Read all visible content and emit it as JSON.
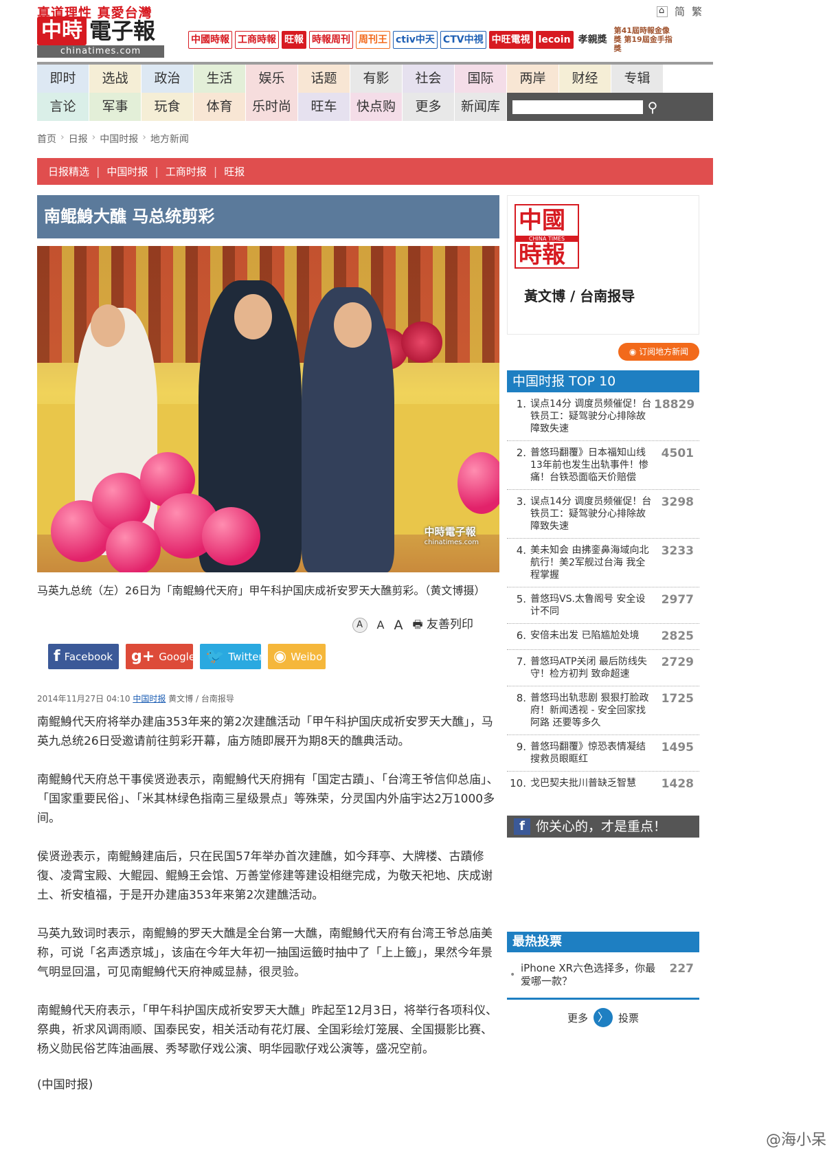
{
  "header": {
    "slogan": "真道理性 真愛台灣",
    "logo_box": "中時",
    "logo_text": "電子報",
    "logo_url": "chinatimes.com",
    "partners": [
      "中國時報",
      "工商時報",
      "旺報",
      "時報周刊",
      "周刊王",
      "ctiv中天",
      "CTV中視",
      "中旺電視",
      "lecoin",
      "孝親獎",
      "第41屆時報金像獎 第19屆金手指獎"
    ],
    "lang": [
      "简",
      "繁"
    ]
  },
  "nav": {
    "row1": [
      "即时",
      "选战",
      "政治",
      "生活",
      "娱乐",
      "话题",
      "有影",
      "社会",
      "国际",
      "两岸",
      "财经",
      "专辑"
    ],
    "row2": [
      "言论",
      "军事",
      "玩食",
      "体育",
      "乐时尚",
      "旺车",
      "快点购",
      "更多",
      "新闻库"
    ],
    "search_placeholder": ""
  },
  "breadcrumb": [
    "首页",
    "日报",
    "中国时报",
    "地方新闻"
  ],
  "subnav": [
    "日报精选",
    "中国时报",
    "工商时报",
    "旺报"
  ],
  "article": {
    "title": "南鲲鯓大醮 马总统剪彩",
    "photo_watermark": "中時電子報",
    "photo_watermark_url": "chinatimes.com",
    "caption": "马英九总统（左）26日为「南鲲鯓代天府」甲午科护国庆成祈安罗天大醮剪彩。（黄文博摄）",
    "font_sizes": [
      "A",
      "A",
      "A"
    ],
    "print_label": "友善列印",
    "meta_date": "2014年11月27日 04:10",
    "meta_source": "中国时报",
    "meta_author": "黄文博 / 台南报导",
    "paragraphs": [
      "南鲲鯓代天府将举办建庙353年来的第2次建醮活动「甲午科护国庆成祈安罗天大醮」，马英九总统26日受邀请前往剪彩开幕，庙方随即展开为期8天的醮典活动。",
      "南鲲鯓代天府总干事侯贤逊表示，南鲲鯓代天府拥有「国定古蹟」、「台湾王爷信仰总庙」、「国家重要民俗」、「米其林绿色指南三星级景点」等殊荣，分灵国内外庙宇达2万1000多间。",
      "侯贤逊表示，南鲲鯓建庙后，只在民国57年举办首次建醮，如今拜亭、大牌楼、古蹟修復、凌霄宝殿、大鲲园、鲲鯓王会馆、万善堂修建等建设相继完成，为敬天祀地、庆成谢土、祈安植福，于是开办建庙353年来第2次建醮活动。",
      "马英九致词时表示，南鲲鯓的罗天大醮是全台第一大醮，南鲲鯓代天府有台湾王爷总庙美称，可说「名声透京城」，该庙在今年大年初一抽国运籤时抽中了「上上籤」，果然今年景气明显回温，可见南鲲鯓代天府神威显赫，很灵验。",
      "南鲲鯓代天府表示，「甲午科护国庆成祈安罗天大醮」昨起至12月3日，将举行各项科仪、祭典，祈求风调雨顺、国泰民安，相关活动有花灯展、全国彩绘灯笼展、全国摄影比赛、杨义勋民俗艺阵油画展、秀琴歌仔戏公演、明华园歌仔戏公演等，盛况空前。"
    ],
    "source_note": "(中国时报)"
  },
  "share": [
    "Facebook",
    "Google+",
    "Twitter",
    "Weibo"
  ],
  "sidebar": {
    "logo_top": "中國",
    "logo_mid": "CHINA TIMES",
    "logo_bot": "時報",
    "reporter": "黃文博 / 台南报导",
    "subscribe": "订阅地方新闻",
    "top10_title": "中国时报 TOP 10",
    "top10": [
      {
        "num": "1.",
        "text": "误点14分 调度员频催促！台铁员工：疑驾驶分心排除故障致失速",
        "count": "18829"
      },
      {
        "num": "2.",
        "text": "普悠玛翻覆》日本福知山线13年前也发生出轨事件！惨痛！台铁恐面临天价赔偿",
        "count": "4501"
      },
      {
        "num": "3.",
        "text": "误点14分 调度员频催促！台铁员工：疑驾驶分心排除故障致失速",
        "count": "3298"
      },
      {
        "num": "4.",
        "text": "美未知会 由拂銮鼻海域向北航行！美2军舰过台海 我全程掌握",
        "count": "3233"
      },
      {
        "num": "5.",
        "text": "普悠玛VS.太鲁阁号 安全设计不同",
        "count": "2977"
      },
      {
        "num": "6.",
        "text": "安倍未出发 已陷尴尬处境",
        "count": "2825"
      },
      {
        "num": "7.",
        "text": "普悠玛ATP关闭 最后防线失守！检方初判 致命超速",
        "count": "2729"
      },
      {
        "num": "8.",
        "text": "普悠玛出轨悲剧 狠狠打脸政府！新闻透视 - 安全回家找阿路 还要等多久",
        "count": "1725"
      },
      {
        "num": "9.",
        "text": "普悠玛翻覆》惊恐表情凝结 搜救员眼眶红",
        "count": "1495"
      },
      {
        "num": "10.",
        "text": "戈巴契夫批川普缺乏智慧",
        "count": "1428"
      }
    ],
    "fb_banner": "你关心的，才是重点！",
    "vote_title": "最热投票",
    "vote": {
      "text": "iPhone XR六色选择多，你最爱哪一款？",
      "count": "227"
    },
    "more_label": "更多",
    "vote_label": "投票"
  },
  "weibo_watermark": "@海小呆"
}
